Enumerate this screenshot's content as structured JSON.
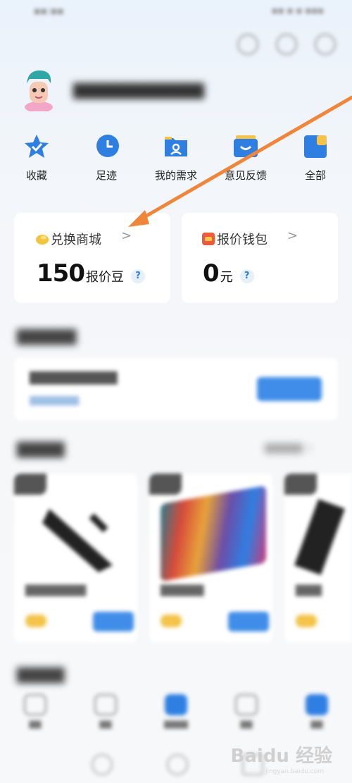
{
  "quick_actions": [
    {
      "label": "收藏",
      "icon": "star-badge-icon"
    },
    {
      "label": "足迹",
      "icon": "clock-icon"
    },
    {
      "label": "我的需求",
      "icon": "folder-user-icon"
    },
    {
      "label": "意见反馈",
      "icon": "feedback-icon"
    },
    {
      "label": "全部",
      "icon": "grid-icon"
    }
  ],
  "exchange_card": {
    "title": "兑换商城",
    "value": "150",
    "unit": "报价豆",
    "help": "?",
    "chevron": ">"
  },
  "wallet_card": {
    "title": "报价钱包",
    "value": "0",
    "unit": "元",
    "help": "?",
    "chevron": ">"
  },
  "watermark": {
    "brand": "Baidu 经验",
    "url": "jingyan.baidu.com"
  },
  "colors": {
    "accent_blue": "#2d7fe0",
    "arrow_orange": "#f0863a"
  }
}
